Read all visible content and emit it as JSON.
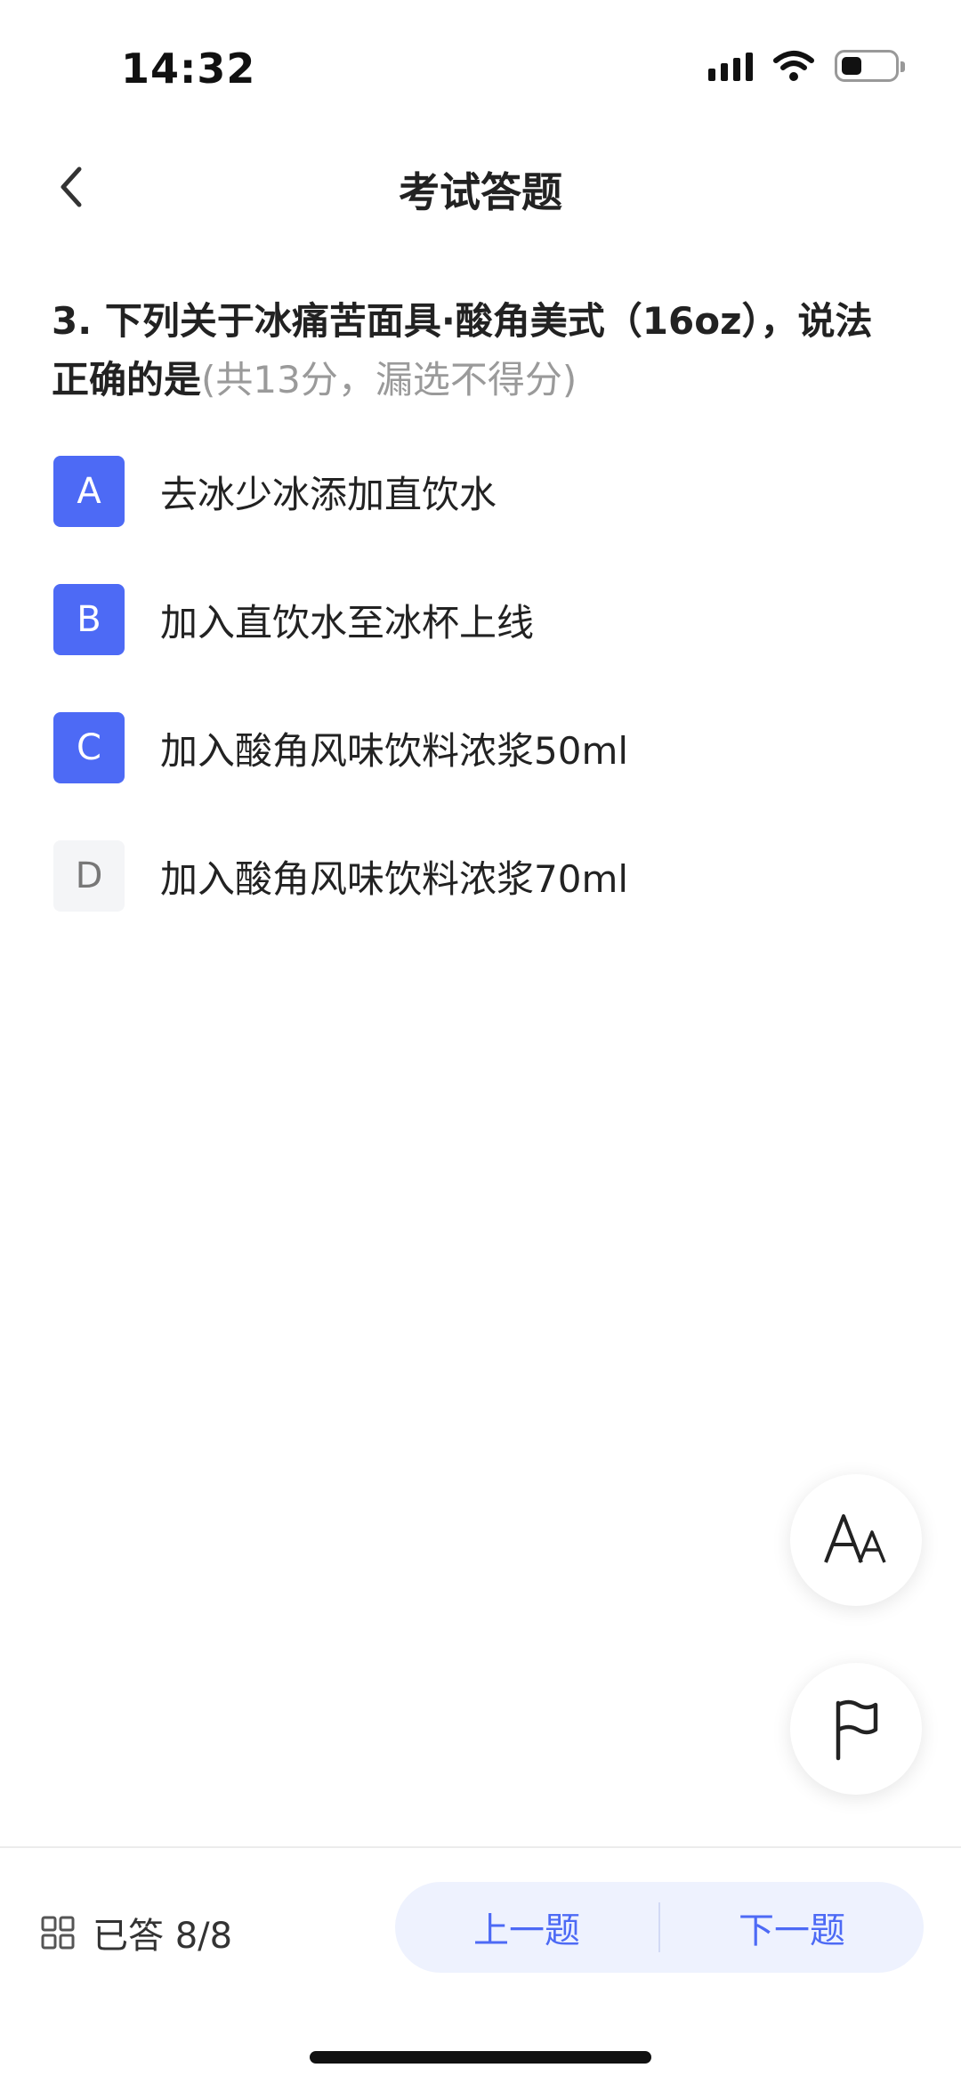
{
  "status_bar": {
    "time": "14:32",
    "icons": [
      "signal-icon",
      "wifi-icon",
      "battery-icon"
    ]
  },
  "nav": {
    "title": "考试答题",
    "back_icon": "chevron-left-icon"
  },
  "question": {
    "number": "3.",
    "text": "下列关于冰痛苦面具·酸角美式（16oz），说法正确的是",
    "note": "(共13分，漏选不得分)"
  },
  "options": [
    {
      "letter": "A",
      "text": "去冰少冰添加直饮水",
      "selected": true
    },
    {
      "letter": "B",
      "text": "加入直饮水至冰杯上线",
      "selected": true
    },
    {
      "letter": "C",
      "text": "加入酸角风味饮料浓浆50ml",
      "selected": true
    },
    {
      "letter": "D",
      "text": "加入酸角风味饮料浓浆70ml",
      "selected": false
    }
  ],
  "floating": {
    "font_size_icon": "font-size-icon",
    "flag_icon": "flag-icon"
  },
  "bottom_bar": {
    "grid_icon": "grid-icon",
    "answered_label": "已答 8/8",
    "prev_label": "上一题",
    "next_label": "下一题"
  },
  "colors": {
    "accent": "#4d6af5",
    "accent_light": "#eef2fe",
    "note_gray": "#9a9a9a"
  }
}
